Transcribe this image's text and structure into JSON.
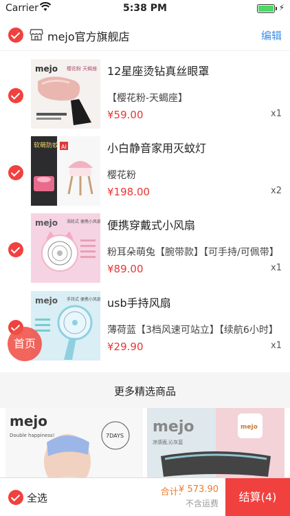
{
  "status_bar": {
    "carrier": "Carrier",
    "time": "5:38 PM"
  },
  "shop": {
    "name": "mejo官方旗舰店",
    "edit_label": "编辑"
  },
  "items": [
    {
      "name": "12星座烫钻真丝眼罩",
      "spec": "【樱花粉-天蝎座】",
      "price": "¥59.00",
      "qty": "x1",
      "thumb_brand": "mejo",
      "thumb_text": "樱花粉 天蝎座"
    },
    {
      "name": "小白静音家用灭蚊灯",
      "spec": "樱花粉",
      "price": "¥198.00",
      "qty": "x2",
      "thumb_brand": "软萌防蚊",
      "thumb_text": "AI"
    },
    {
      "name": "便携穿戴式小风扇",
      "spec": "粉耳朵萌兔【腕带款】【可手持/可佩带】",
      "price": "¥89.00",
      "qty": "x1",
      "thumb_brand": "mejo",
      "thumb_text": "涡轮式 便携小风扇"
    },
    {
      "name": "usb手持风扇",
      "spec": "薄荷蓝【3档风速可站立】【续航6小时】",
      "price": "¥29.90",
      "qty": "x1",
      "thumb_brand": "mejo",
      "thumb_text": "手持式 便携小风扇"
    }
  ],
  "home_button": "首页",
  "more": {
    "title": "更多精选商品"
  },
  "recommend": [
    {
      "brand": "mejo",
      "tagline": "Double happiness!",
      "badge": "7DAYS"
    },
    {
      "brand": "mejo",
      "tagline": "凉感面,沁灰蓝",
      "badge": "mejo"
    }
  ],
  "footer": {
    "select_all": "全选",
    "total_label": "合计:",
    "total": "¥ 573.90",
    "shipping": "不含运费",
    "checkout": "结算(4)"
  }
}
